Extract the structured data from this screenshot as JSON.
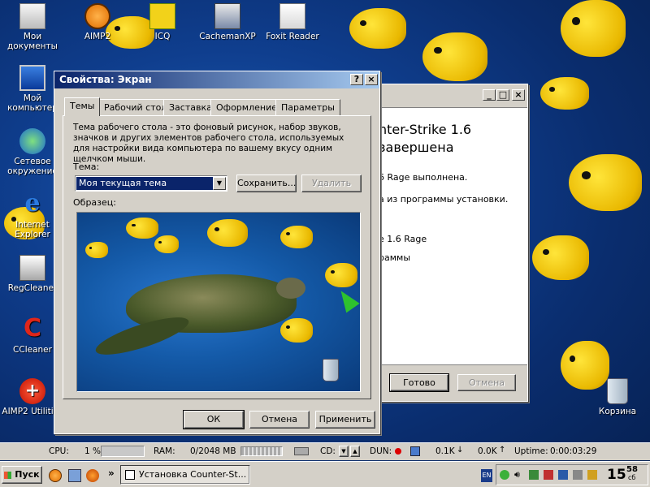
{
  "desktop": {
    "icons": [
      {
        "label": "Мои\nдокументы",
        "icon": "my-documents-icon"
      },
      {
        "label": "AIMP2",
        "icon": "aimp-icon"
      },
      {
        "label": "ICQ",
        "icon": "icq-icon"
      },
      {
        "label": "CachemanXP",
        "icon": "cachemanxp-icon"
      },
      {
        "label": "Foxit Reader",
        "icon": "foxit-reader-icon"
      },
      {
        "label": "Мой\nкомпьютер",
        "icon": "my-computer-icon"
      },
      {
        "label": "Сетевое\nокружение",
        "icon": "network-icon"
      },
      {
        "label": "Internet\nExplorer",
        "icon": "ie-icon"
      },
      {
        "label": "RegCleaner",
        "icon": "regcleaner-icon"
      },
      {
        "label": "CCleaner",
        "icon": "ccleaner-icon"
      },
      {
        "label": "AIMP2 Utilities",
        "icon": "aimp-utilities-icon"
      },
      {
        "label": "Корзина",
        "icon": "recycle-bin-icon"
      }
    ]
  },
  "bg_window": {
    "heading_line1": "nter-Strike 1.6",
    "heading_line2": "завершена",
    "lines": [
      "6 Rage выполнена.",
      "а из программы установки.",
      "e 1.6 Rage",
      "раммы"
    ],
    "ok_button": "Готово",
    "cancel_button": "Отмена"
  },
  "dialog": {
    "title": "Свойства: Экран",
    "help_btn": "?",
    "close_btn": "×",
    "tabs": [
      "Темы",
      "Рабочий стол",
      "Заставка",
      "Оформление",
      "Параметры"
    ],
    "description": "Тема рабочего стола - это фоновый рисунок, набор звуков, значков и других элементов рабочего стола, используемых для настройки вида компьютера по вашему вкусу одним щелчком мыши.",
    "theme_label": "Тема:",
    "theme_value": "Моя текущая тема",
    "save_button": "Сохранить...",
    "delete_button": "Удалить",
    "sample_label": "Образец:",
    "ok_button": "ОК",
    "cancel_button": "Отмена",
    "apply_button": "Применить"
  },
  "sysmon": {
    "cpu_label": "CPU:",
    "cpu_value": "1 %",
    "ram_label": "RAM:",
    "ram_value": "0/2048 MB",
    "cd_label": "CD:",
    "dun_label": "DUN:",
    "down_value": "0.1K",
    "up_value": "0.0K",
    "uptime_label": "Uptime:",
    "uptime_value": "0:00:03:29"
  },
  "taskbar": {
    "start_label": "Пуск",
    "task_label": "Установка Counter-St...",
    "lang": "EN",
    "clock_hours": "15",
    "clock_minutes": "58",
    "clock_sub": "сб"
  },
  "colors": {
    "accent_title": "#0a246a",
    "select_bg": "#0a246a",
    "wallpaper": "#0f3e8e",
    "fish": "#ffe53a"
  }
}
